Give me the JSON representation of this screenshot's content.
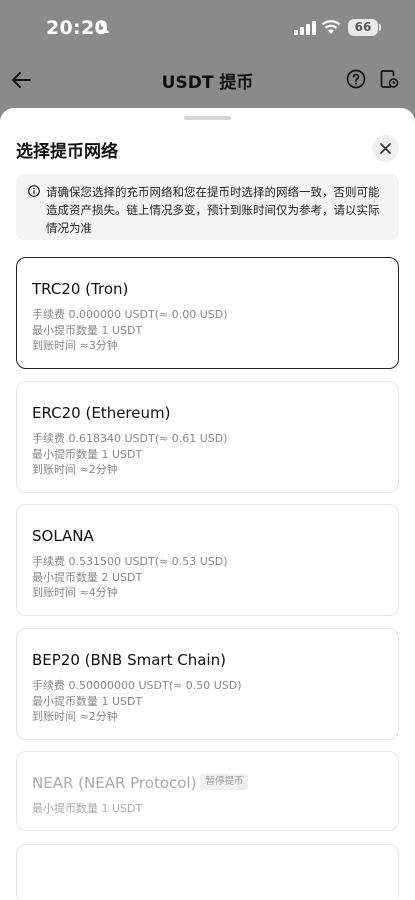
{
  "status_bar": {
    "time": "20:20",
    "battery": "66"
  },
  "nav": {
    "title": "USDT 提币"
  },
  "sheet": {
    "title": "选择提币网络",
    "notice": "请确保您选择的充币网络和您在提币时选择的网络一致，否则可能造成资产损失。链上情况多变，预计到账时间仅为参考，请以实际情况为准"
  },
  "networks": [
    {
      "name": "TRC20 (Tron)",
      "fee": "手续费 0.000000 USDT(≈ 0.00 USD)",
      "min": "最小提币数量 1 USDT",
      "eta": "到账时间 ≈3分钟",
      "selected": true
    },
    {
      "name": "ERC20 (Ethereum)",
      "fee": "手续费 0.618340 USDT(≈ 0.61 USD)",
      "min": "最小提币数量 1 USDT",
      "eta": "到账时间 ≈2分钟"
    },
    {
      "name": "SOLANA",
      "fee": "手续费 0.531500 USDT(≈ 0.53 USD)",
      "min": "最小提币数量 2 USDT",
      "eta": "到账时间 ≈4分钟"
    },
    {
      "name": "BEP20 (BNB Smart Chain)",
      "fee": "手续费 0.50000000 USDT(≈ 0.50 USD)",
      "min": "最小提币数量 1 USDT",
      "eta": "到账时间 ≈2分钟"
    },
    {
      "name": "NEAR (NEAR Protocol)",
      "badge": "暂停提币",
      "min": "最小提币数量 1 USDT",
      "disabled": true
    }
  ],
  "icons": {
    "back": "arrow-left-icon",
    "help": "question-icon",
    "history": "history-icon",
    "close": "close-icon",
    "info": "info-icon",
    "person": "person-icon",
    "signal": "signal-icon",
    "wifi": "wifi-icon"
  }
}
